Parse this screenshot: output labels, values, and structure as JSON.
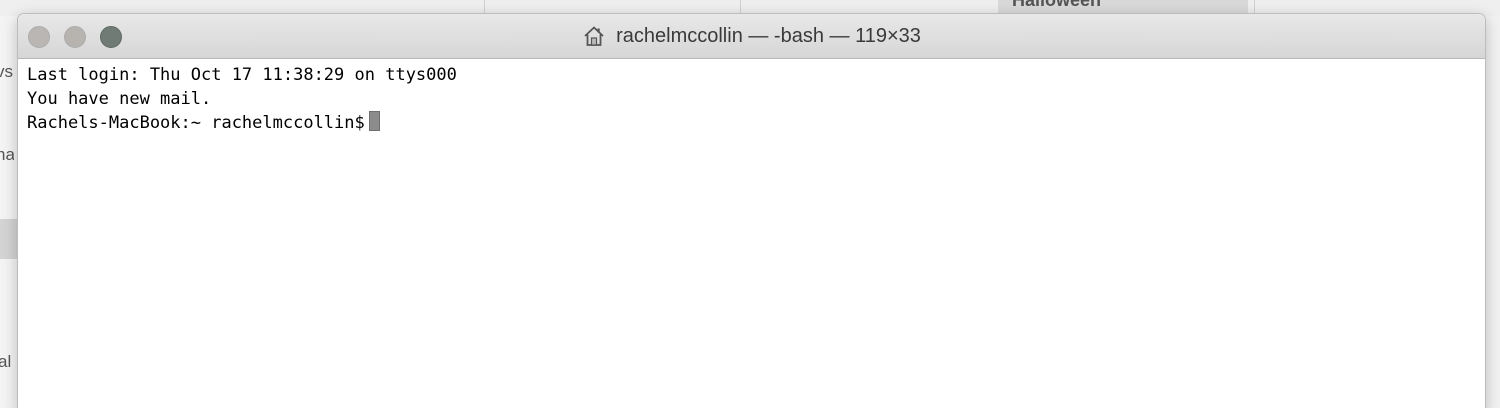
{
  "background": {
    "tab_label": "Halloween",
    "left_fragments": [
      "vs",
      "na",
      "al"
    ]
  },
  "window": {
    "title": "rachelmccollin — -bash — 119×33",
    "icon": "home-icon"
  },
  "terminal": {
    "lines": [
      "Last login: Thu Oct 17 11:38:29 on ttys000",
      "You have new mail."
    ],
    "prompt": "Rachels-MacBook:~ rachelmccollin$"
  },
  "colors": {
    "close": "#b9b6b3",
    "minimize": "#b7b3af",
    "zoom": "#6f7b74",
    "cursor": "#8c8c8c"
  }
}
